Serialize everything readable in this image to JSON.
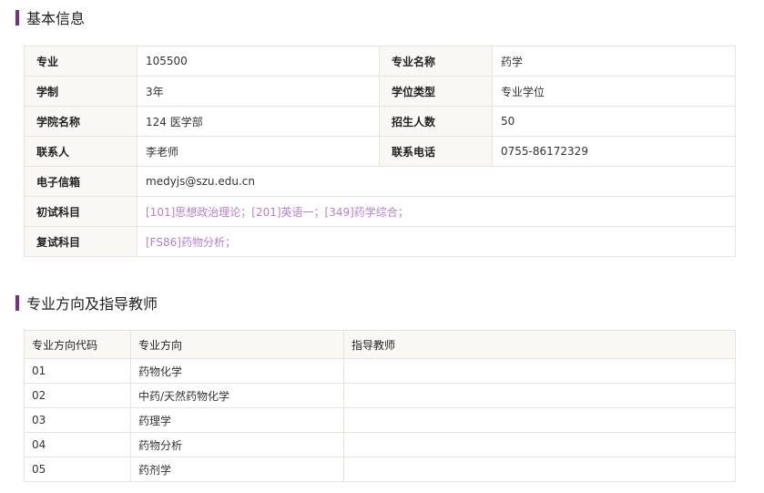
{
  "section1": {
    "title": "基本信息"
  },
  "info": {
    "major_label": "专业",
    "major_value": "105500",
    "name_label": "专业名称",
    "name_value": "药学",
    "duration_label": "学制",
    "duration_value": "3年",
    "degree_label": "学位类型",
    "degree_value": "专业学位",
    "college_label": "学院名称",
    "college_value": "124 医学部",
    "quota_label": "招生人数",
    "quota_value": "50",
    "contact_label": "联系人",
    "contact_value": "李老师",
    "phone_label": "联系电话",
    "phone_value": "0755-86172329",
    "email_label": "电子信箱",
    "email_value": "medyjs@szu.edu.cn",
    "prelim_label": "初试科目",
    "prelim_value": "[101]思想政治理论；[201]英语一；[349]药学综合；",
    "retest_label": "复试科目",
    "retest_value": "[FS86]药物分析；"
  },
  "section2": {
    "title": "专业方向及指导教师"
  },
  "directions": {
    "headers": [
      "专业方向代码",
      "专业方向",
      "指导教师"
    ],
    "rows": [
      {
        "code": "01",
        "name": "药物化学",
        "advisor": ""
      },
      {
        "code": "02",
        "name": "中药/天然药物化学",
        "advisor": ""
      },
      {
        "code": "03",
        "name": "药理学",
        "advisor": ""
      },
      {
        "code": "04",
        "name": "药物分析",
        "advisor": ""
      },
      {
        "code": "05",
        "name": "药剂学",
        "advisor": ""
      }
    ]
  },
  "colors": {
    "accent_bar": "#7b2d8e",
    "link": "#b57fcf",
    "label_bg": "#faf8f5",
    "border": "#e9e3dc"
  }
}
